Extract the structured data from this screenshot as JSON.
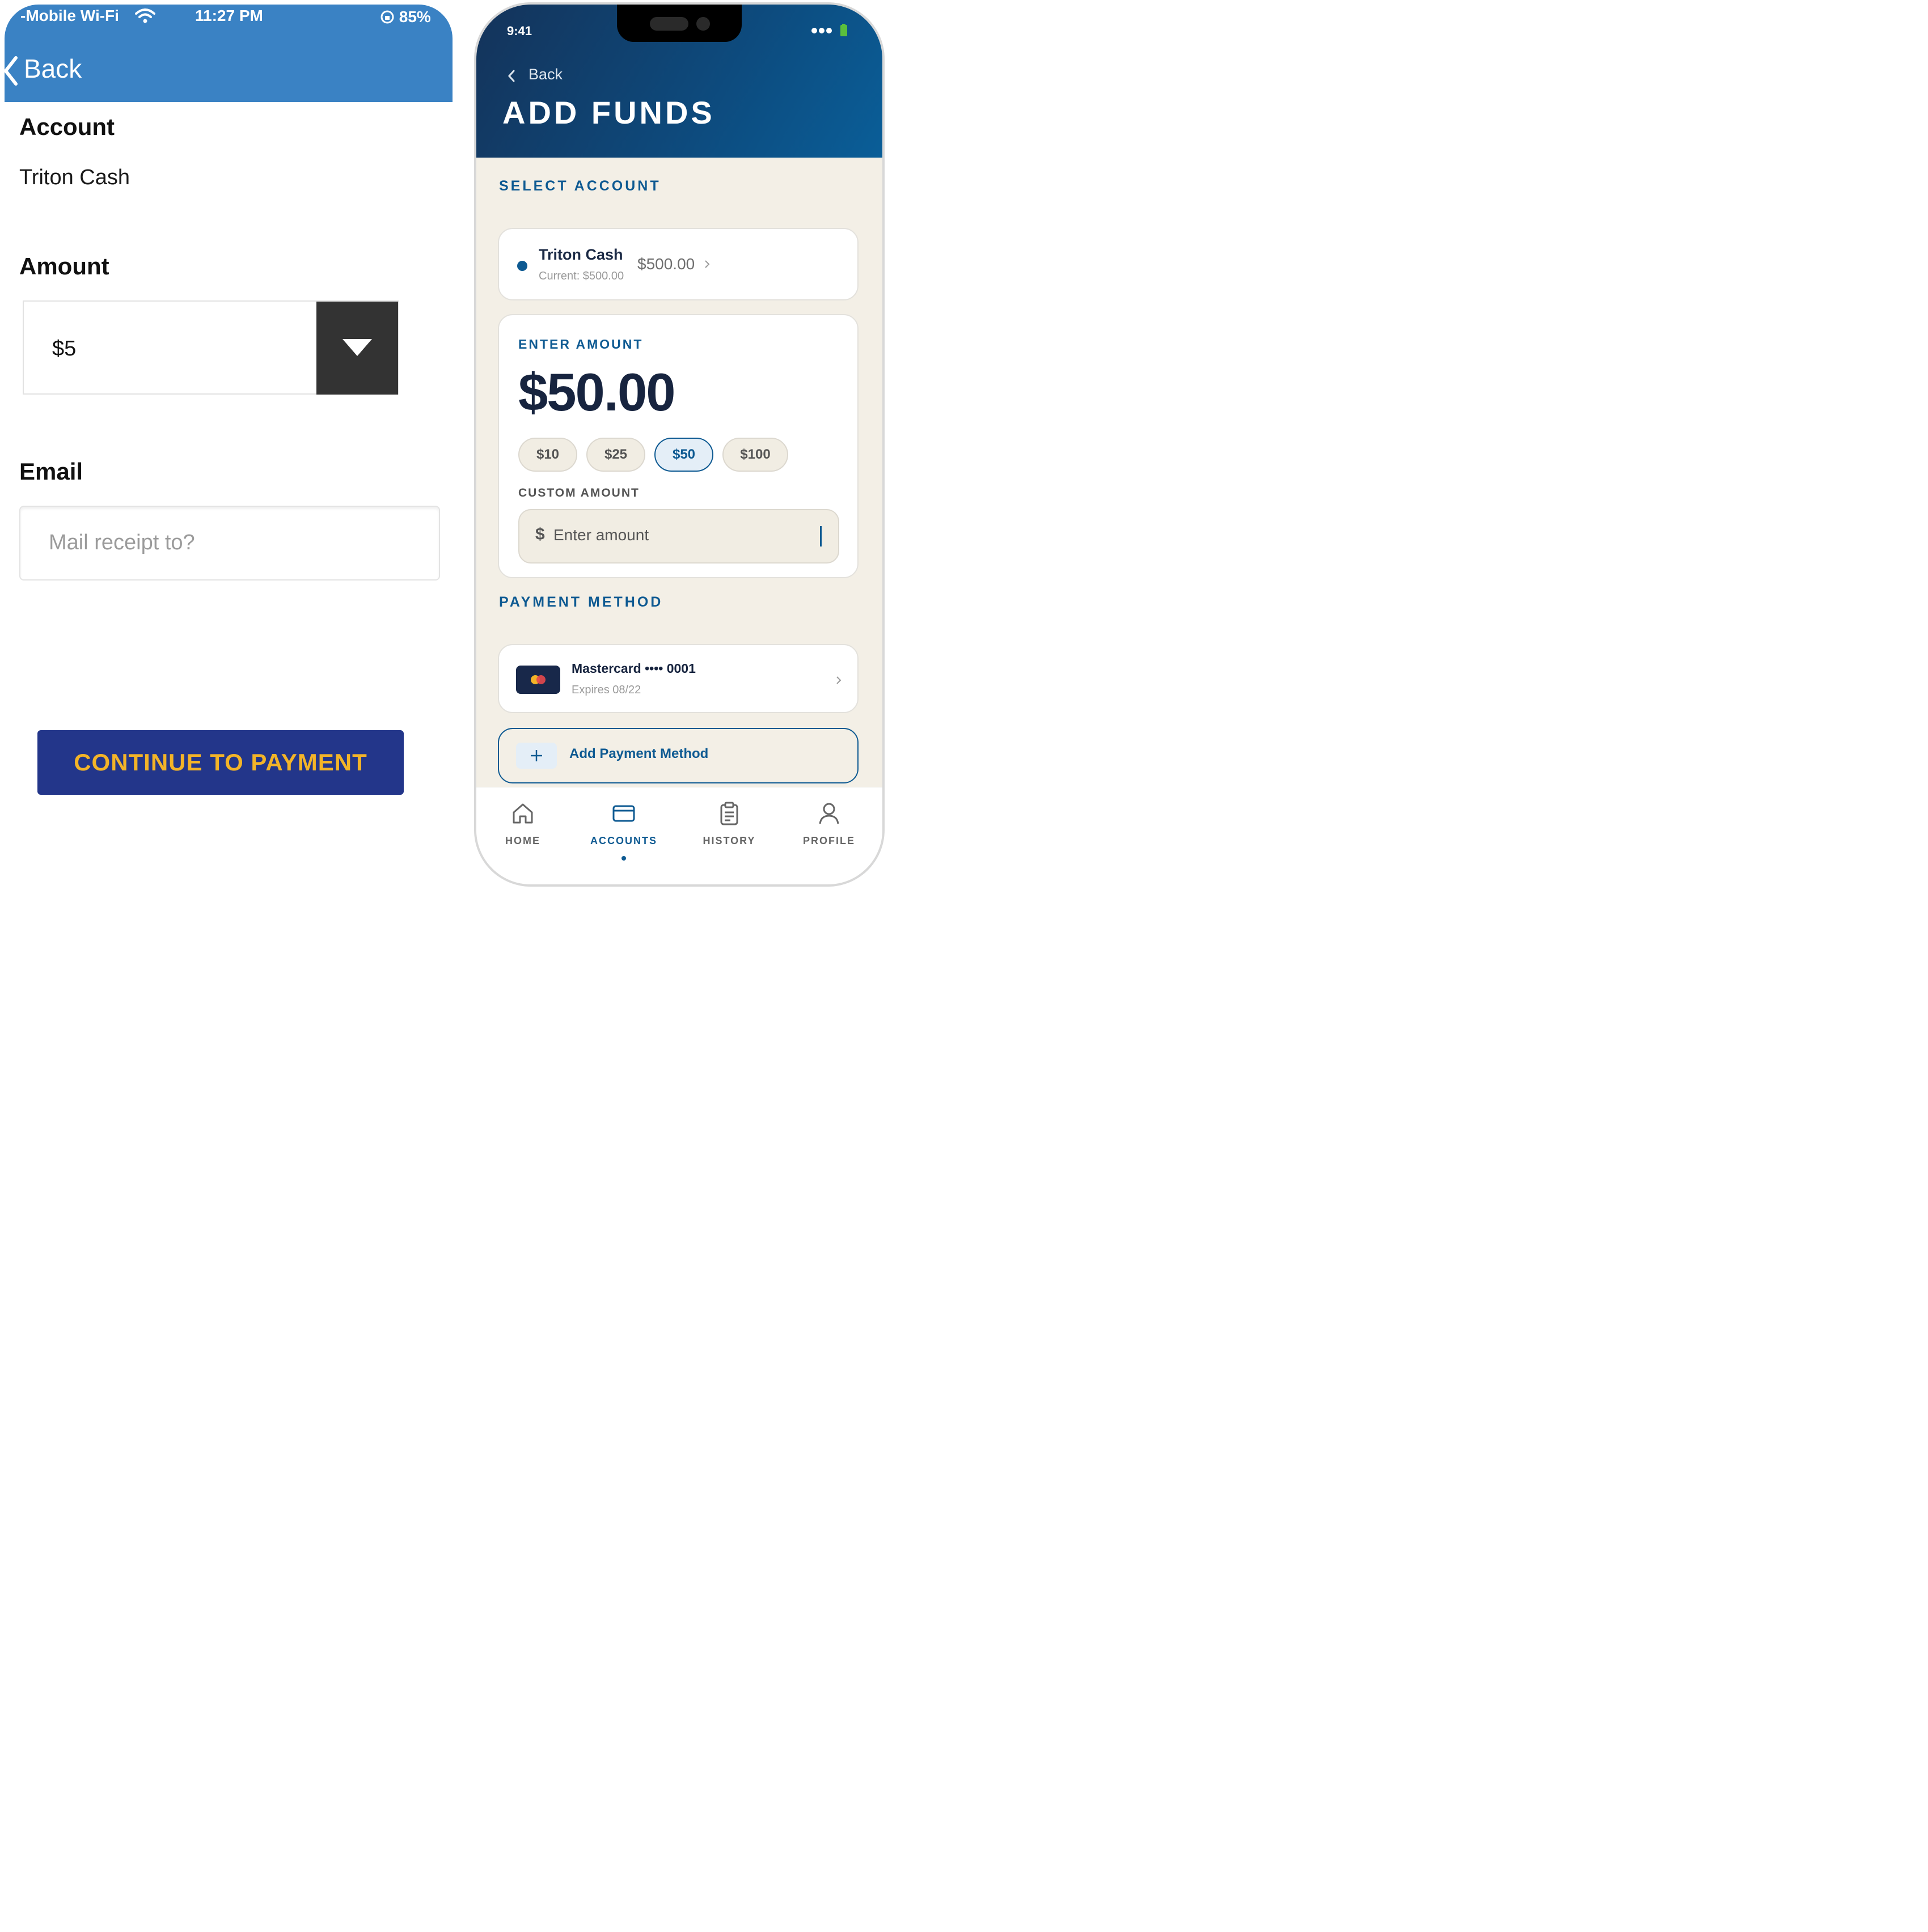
{
  "left": {
    "status": {
      "carrier": "-Mobile Wi-Fi",
      "time": "11:27 PM",
      "battery": "85%"
    },
    "back_label": "Back",
    "account": {
      "label": "Account",
      "value": "Triton Cash"
    },
    "amount": {
      "label": "Amount",
      "selected": "$5"
    },
    "email": {
      "label": "Email",
      "placeholder": "Mail receipt to?"
    },
    "continue_label": "CONTINUE TO PAYMENT",
    "colors": {
      "header": "#3a82c4",
      "button": "#23368a",
      "button_text": "#f3b428"
    }
  },
  "right": {
    "status": {
      "time": "9:41"
    },
    "back_label": "Back",
    "title": "ADD FUNDS",
    "select_account": {
      "heading": "SELECT ACCOUNT",
      "name": "Triton Cash",
      "current": "Current: $500.00",
      "balance": "$500.00"
    },
    "amount": {
      "heading": "ENTER AMOUNT",
      "value": "$50.00",
      "presets": [
        "$10",
        "$25",
        "$50",
        "$100"
      ],
      "selected_preset": "$50",
      "custom_label": "CUSTOM AMOUNT",
      "custom_currency": "$",
      "custom_placeholder": "Enter amount"
    },
    "payment": {
      "heading": "PAYMENT METHOD",
      "card_name": "Mastercard •••• 0001",
      "card_expiry": "Expires 08/22",
      "card_icon": "mastercard-icon",
      "add_label": "Add Payment Method"
    },
    "tabs": [
      {
        "label": "HOME",
        "icon": "home-icon"
      },
      {
        "label": "ACCOUNTS",
        "icon": "card-icon"
      },
      {
        "label": "HISTORY",
        "icon": "clipboard-icon"
      },
      {
        "label": "PROFILE",
        "icon": "user-icon"
      }
    ],
    "active_tab": "ACCOUNTS",
    "colors": {
      "header_start": "#14335a",
      "header_end": "#0a5e98",
      "accent": "#0e5a92",
      "background": "#f3efe6"
    }
  }
}
